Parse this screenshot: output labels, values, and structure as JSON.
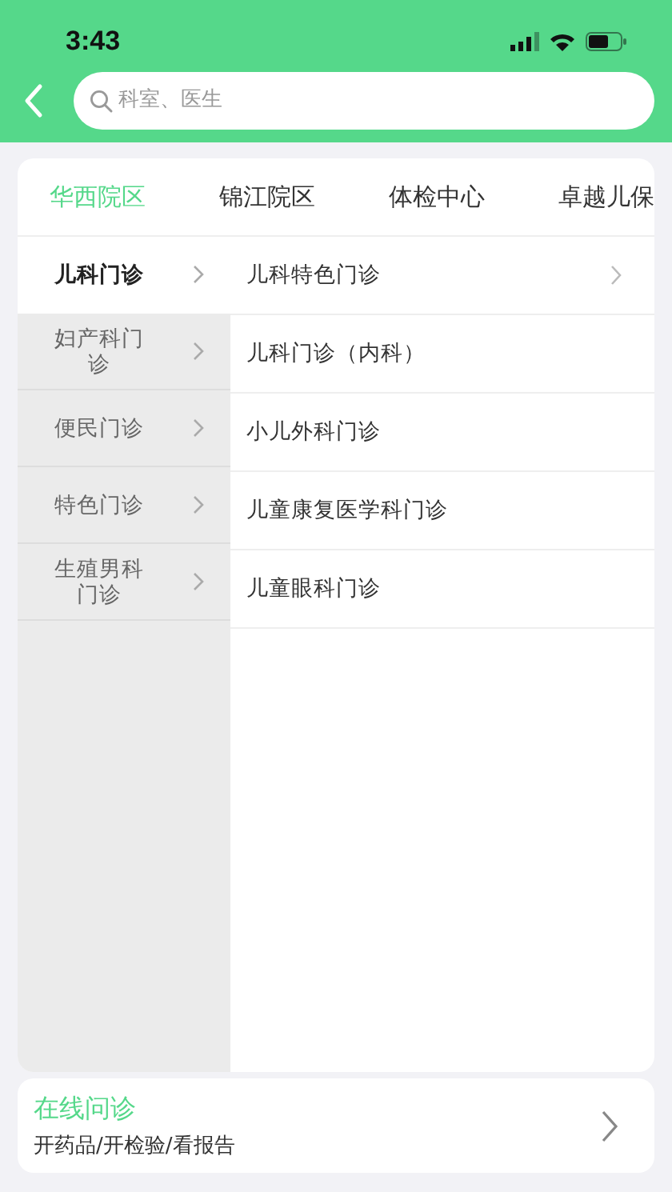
{
  "status_bar": {
    "time": "3:43"
  },
  "search": {
    "placeholder": "科室、医生"
  },
  "tabs": [
    {
      "label": "华西院区",
      "selected": true
    },
    {
      "label": "锦江院区",
      "selected": false
    },
    {
      "label": "体检中心",
      "selected": false
    },
    {
      "label": "卓越儿保",
      "selected": false
    }
  ],
  "categories": [
    {
      "label": "儿科门诊",
      "selected": true
    },
    {
      "label": "妇产科门诊",
      "selected": false
    },
    {
      "label": "便民门诊",
      "selected": false
    },
    {
      "label": "特色门诊",
      "selected": false
    },
    {
      "label": "生殖男科门诊",
      "selected": false
    }
  ],
  "departments": [
    {
      "label": "儿科特色门诊",
      "expandable": true
    },
    {
      "label": "儿科门诊（内科）",
      "expandable": false
    },
    {
      "label": "小儿外科门诊",
      "expandable": false
    },
    {
      "label": "儿童康复医学科门诊",
      "expandable": false
    },
    {
      "label": "儿童眼科门诊",
      "expandable": false
    }
  ],
  "online_card": {
    "title": "在线问诊",
    "subtitle": "开药品/开检验/看报告"
  }
}
